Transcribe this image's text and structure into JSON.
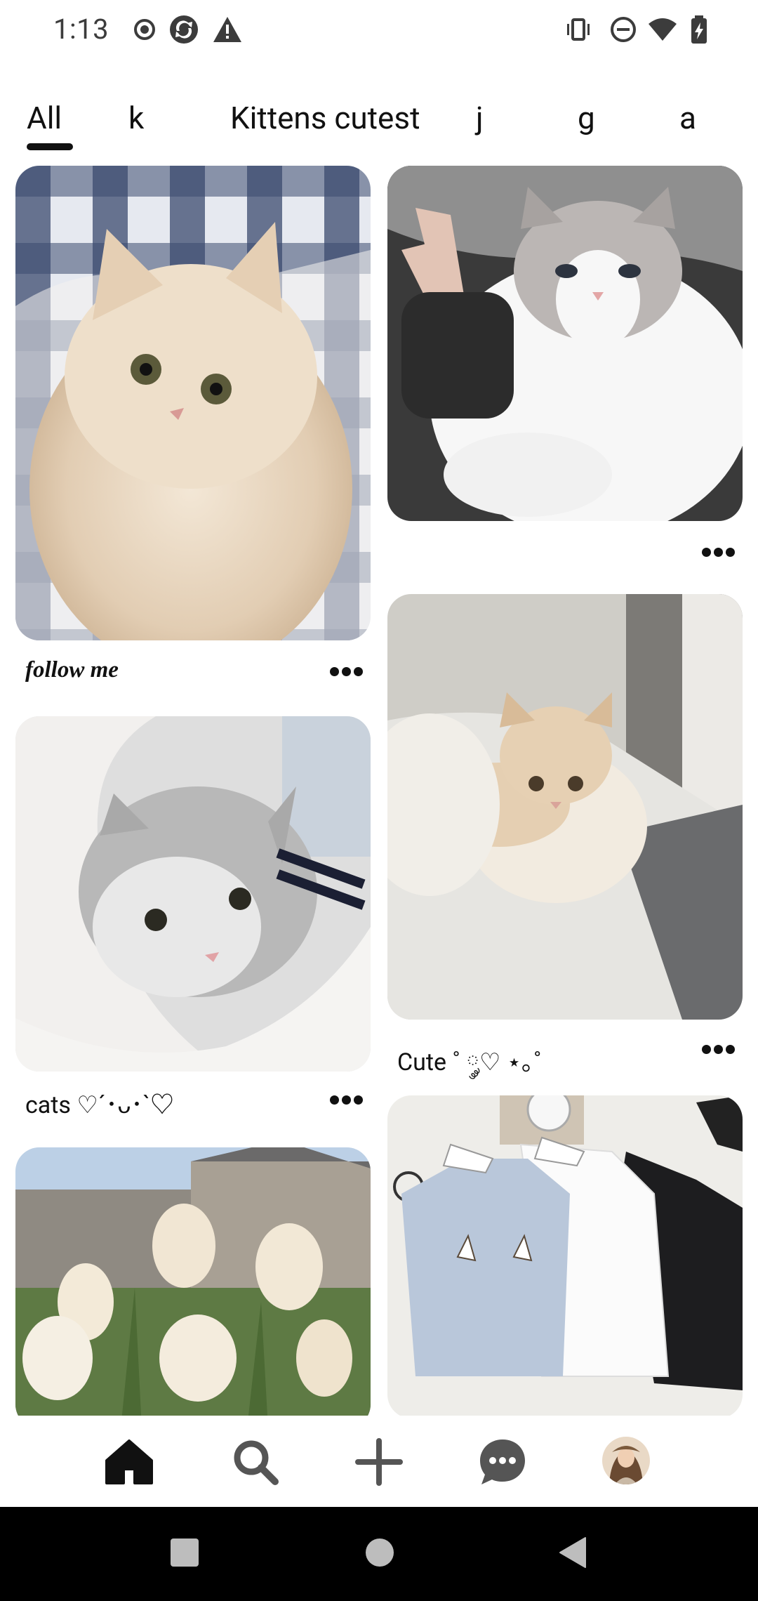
{
  "status_bar": {
    "time": "1:13",
    "left_icons": [
      "record-icon",
      "sync-icon",
      "warning-icon"
    ],
    "right_icons": [
      "vibrate-icon",
      "do-not-disturb-icon",
      "wifi-icon",
      "battery-icon"
    ]
  },
  "tabs": [
    {
      "label": "All",
      "selected": true
    },
    {
      "label": "k"
    },
    {
      "label": "Kittens cutest"
    },
    {
      "label": "j"
    },
    {
      "label": "g"
    },
    {
      "label": "a"
    }
  ],
  "feed": {
    "left_column": [
      {
        "caption": "follow me",
        "image": "fluffy cream kitten on plaid blanket"
      },
      {
        "caption": "cats ♡´･ᴗ･`♡",
        "image": "grey kitten wrapped in white sweater"
      },
      {
        "caption": "",
        "image": "white tulips"
      }
    ],
    "right_column": [
      {
        "caption": "",
        "image": "grey and white cat with peace sign hand"
      },
      {
        "caption": "Cute ˚ ༘♡ ⋆｡˚",
        "image": "cream fluffy kitten on bed"
      },
      {
        "caption": "",
        "image": "cat ear sweatshirts"
      }
    ]
  },
  "bottom_nav": {
    "items": [
      "home-icon",
      "search-icon",
      "create-icon",
      "messages-icon",
      "profile-avatar"
    ]
  },
  "colors": {
    "text": "#111111",
    "background": "#ffffff",
    "system_nav": "#000000"
  }
}
